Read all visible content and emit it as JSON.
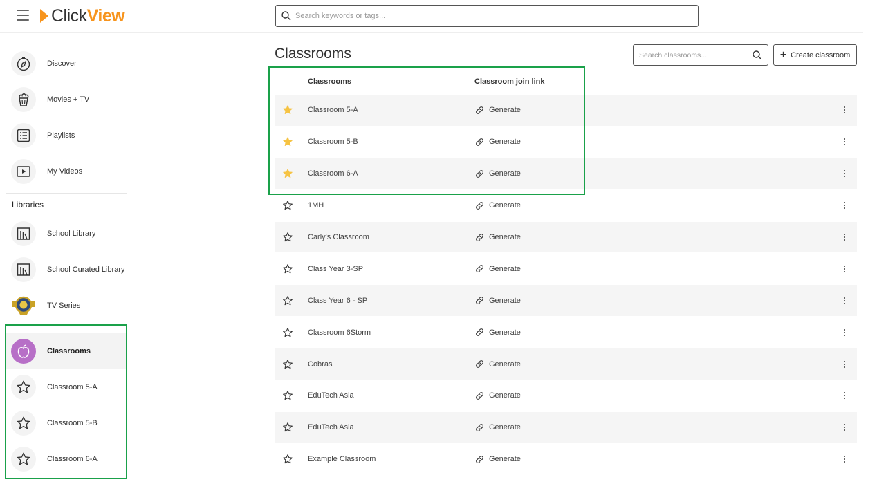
{
  "header": {
    "logo_click": "Click",
    "logo_view": "View",
    "search_placeholder": "Search keywords or tags..."
  },
  "sidebar": {
    "main_items": [
      {
        "label": "Discover",
        "icon": "compass-icon"
      },
      {
        "label": "Movies + TV",
        "icon": "popcorn-icon"
      },
      {
        "label": "Playlists",
        "icon": "playlist-icon"
      },
      {
        "label": "My Videos",
        "icon": "video-play-icon"
      }
    ],
    "libraries_heading": "Libraries",
    "library_items": [
      {
        "label": "School Library",
        "icon": "library-books-icon"
      },
      {
        "label": "School Curated Library",
        "icon": "library-books-icon"
      },
      {
        "label": "TV Series",
        "icon": "crest-logo-icon"
      }
    ],
    "classrooms_item": {
      "label": "Classrooms",
      "icon": "apple-icon"
    },
    "favorite_classrooms": [
      {
        "label": "Classroom 5-A",
        "icon": "star-outline-icon"
      },
      {
        "label": "Classroom 5-B",
        "icon": "star-outline-icon"
      },
      {
        "label": "Classroom 6-A",
        "icon": "star-outline-icon"
      }
    ]
  },
  "main": {
    "title": "Classrooms",
    "search_placeholder": "Search classrooms...",
    "create_label": "Create classroom",
    "columns": {
      "name": "Classrooms",
      "link": "Classroom join link"
    },
    "rows": [
      {
        "name": "Classroom 5-A",
        "favorite": true,
        "link_label": "Generate"
      },
      {
        "name": "Classroom 5-B",
        "favorite": true,
        "link_label": "Generate"
      },
      {
        "name": "Classroom 6-A",
        "favorite": true,
        "link_label": "Generate"
      },
      {
        "name": "1MH",
        "favorite": false,
        "link_label": "Generate"
      },
      {
        "name": "Carly's Classroom",
        "favorite": false,
        "link_label": "Generate"
      },
      {
        "name": "Class Year 3-SP",
        "favorite": false,
        "link_label": "Generate"
      },
      {
        "name": "Class Year 6 - SP",
        "favorite": false,
        "link_label": "Generate"
      },
      {
        "name": "Classroom 6Storm",
        "favorite": false,
        "link_label": "Generate"
      },
      {
        "name": "Cobras",
        "favorite": false,
        "link_label": "Generate"
      },
      {
        "name": "EduTech Asia",
        "favorite": false,
        "link_label": "Generate"
      },
      {
        "name": "EduTech Asia",
        "favorite": false,
        "link_label": "Generate"
      },
      {
        "name": "Example Classroom",
        "favorite": false,
        "link_label": "Generate"
      }
    ]
  },
  "colors": {
    "brand_orange": "#f7941d",
    "active_purple": "#b76fc7",
    "star_filled": "#f6c343",
    "highlight_green": "#1aa14a"
  }
}
